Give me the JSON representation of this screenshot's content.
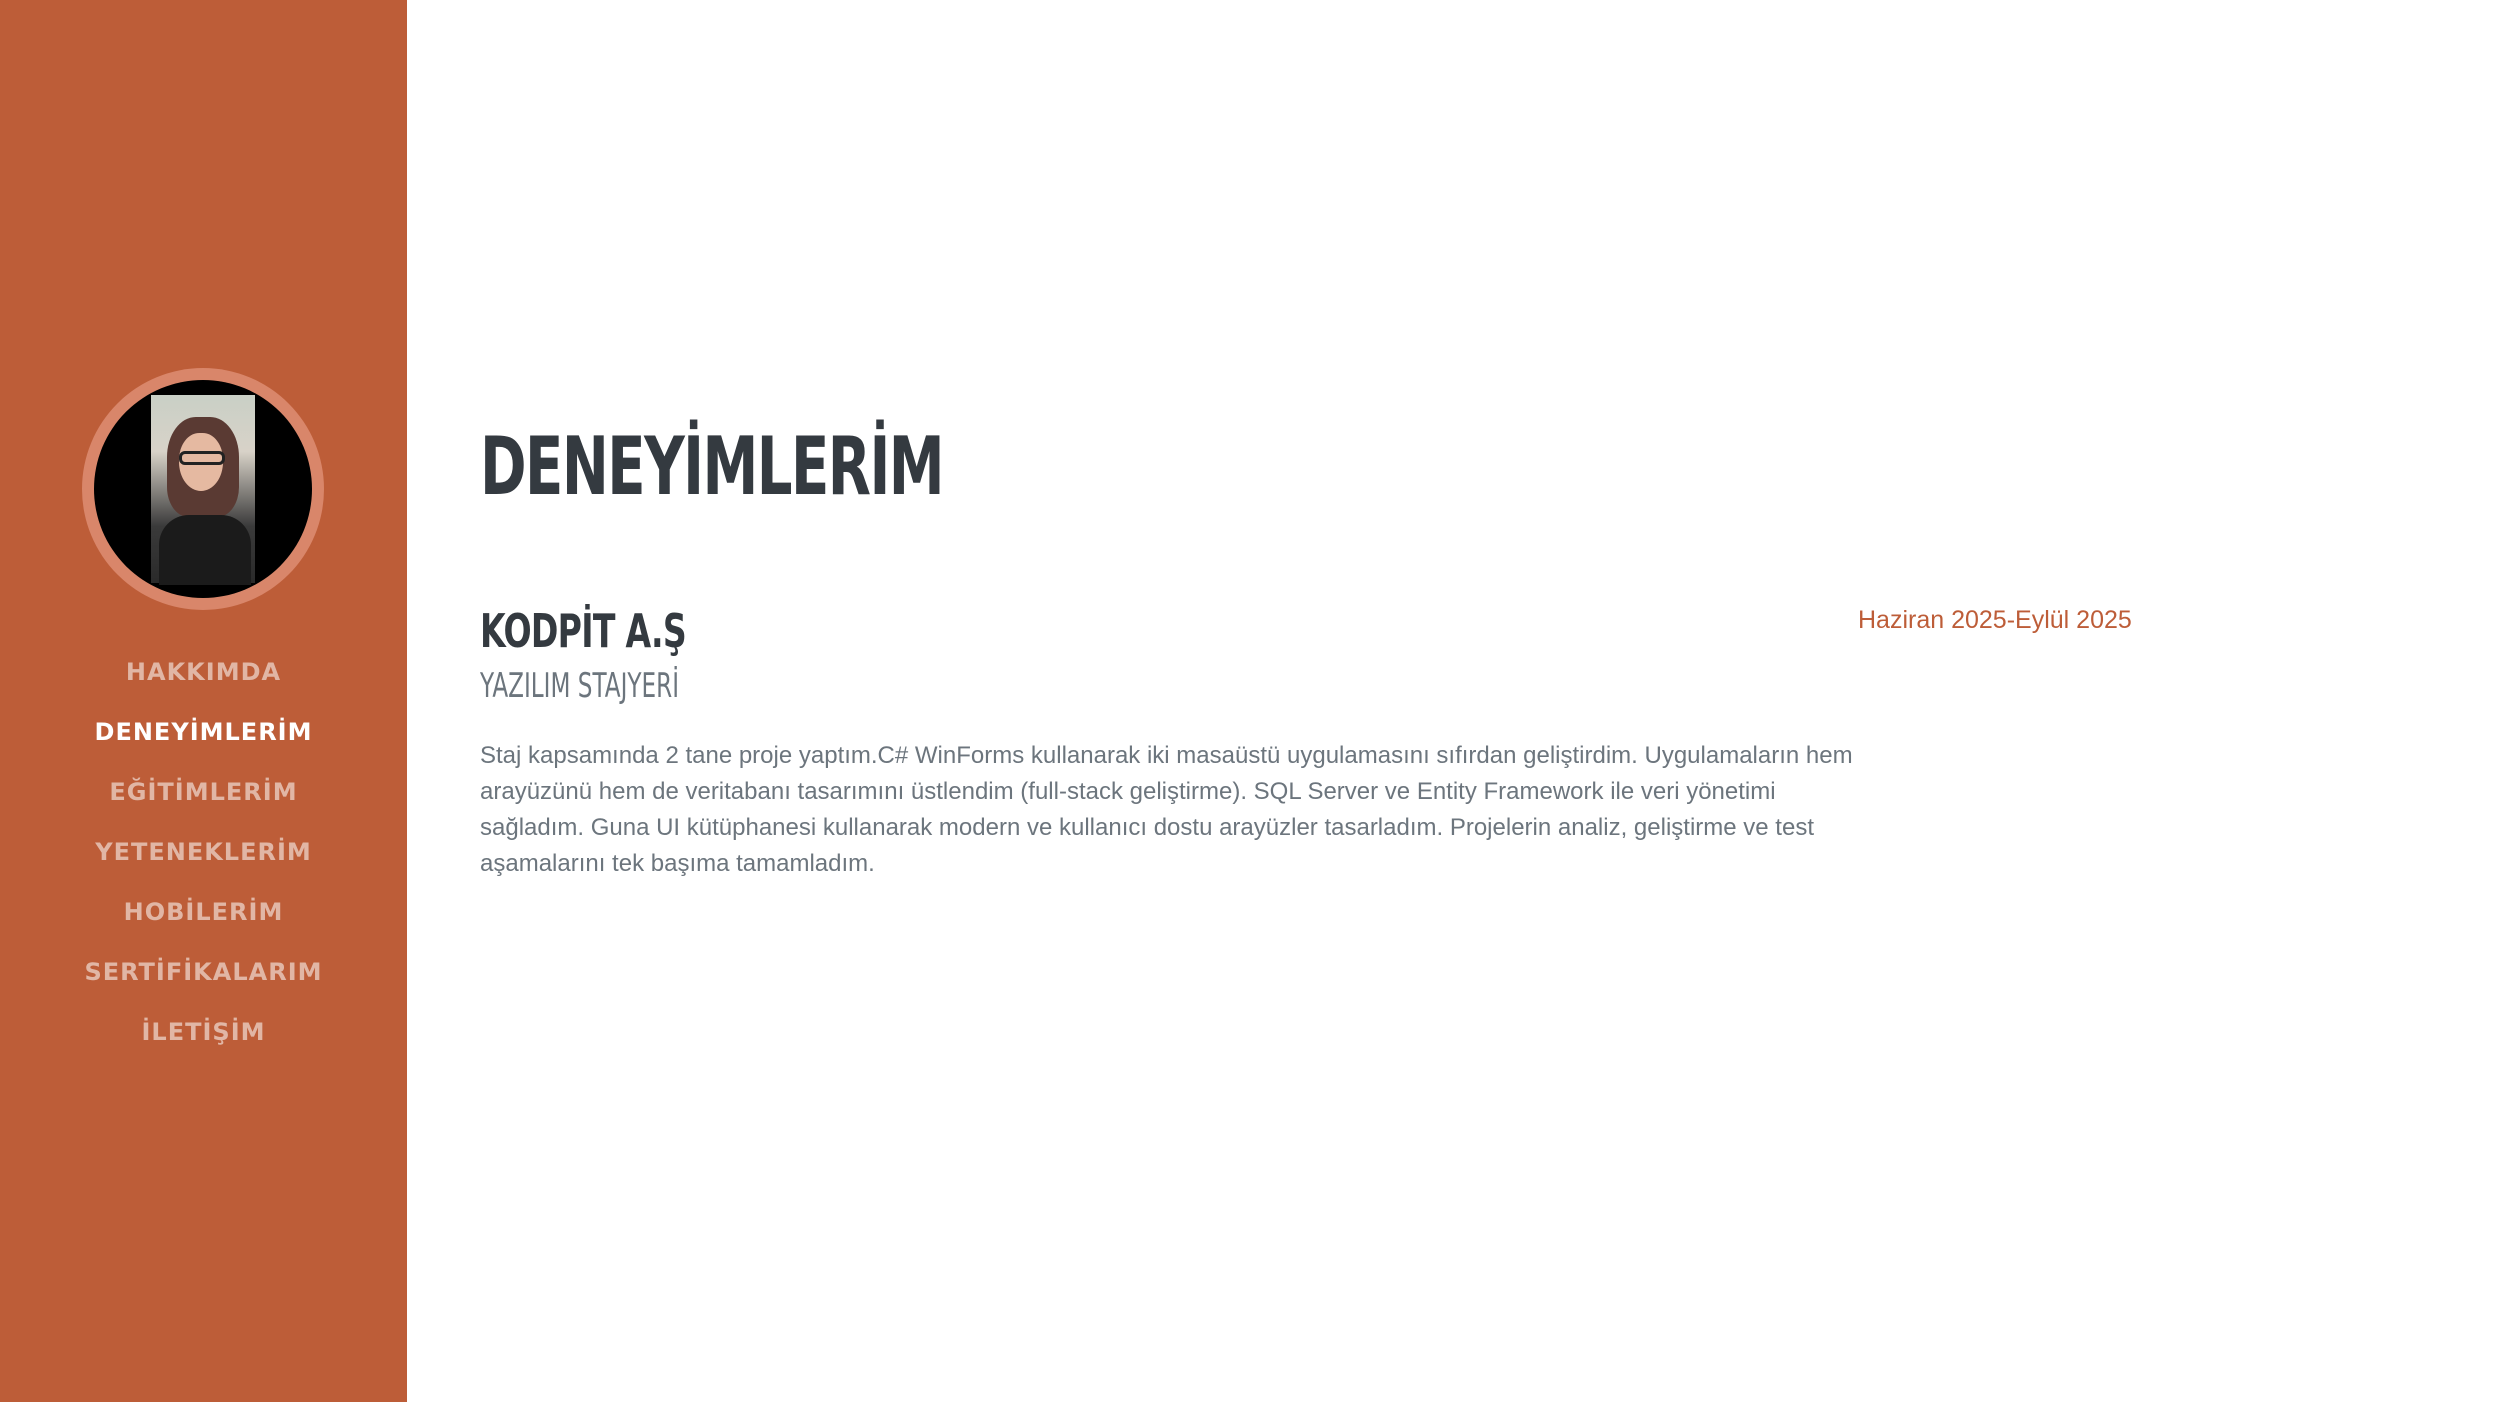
{
  "colors": {
    "sidebar": "#bd5d38",
    "heading": "#343a40",
    "text": "#6c757d",
    "accent": "#bd5d38"
  },
  "sidebar": {
    "avatar": "profile-photo",
    "nav": [
      {
        "label": "HAKKIMDA",
        "active": false
      },
      {
        "label": "DENEYİMLERİM",
        "active": true
      },
      {
        "label": "EĞİTİMLERİM",
        "active": false
      },
      {
        "label": "YETENEKLERİM",
        "active": false
      },
      {
        "label": "HOBİLERİM",
        "active": false
      },
      {
        "label": "SERTİFİKALARIM",
        "active": false
      },
      {
        "label": "İLETİŞİM",
        "active": false
      }
    ]
  },
  "main": {
    "title": "DENEYİMLERİM",
    "experience": {
      "company": "KODPİT A.Ş",
      "role": "YAZILIM STAJYERİ",
      "date": "Haziran 2025-Eylül 2025",
      "description": "Staj kapsamında 2 tane proje yaptım.C# WinForms kullanarak iki masaüstü uygulamasını sıfırdan geliştirdim. Uygulamaların hem arayüzünü hem de veritabanı tasarımını üstlendim (full-stack geliştirme). SQL Server ve Entity Framework ile veri yönetimi sağladım. Guna UI kütüphanesi kullanarak modern ve kullanıcı dostu arayüzler tasarladım. Projelerin analiz, geliştirme ve test aşamalarını tek başıma tamamladım."
    }
  }
}
